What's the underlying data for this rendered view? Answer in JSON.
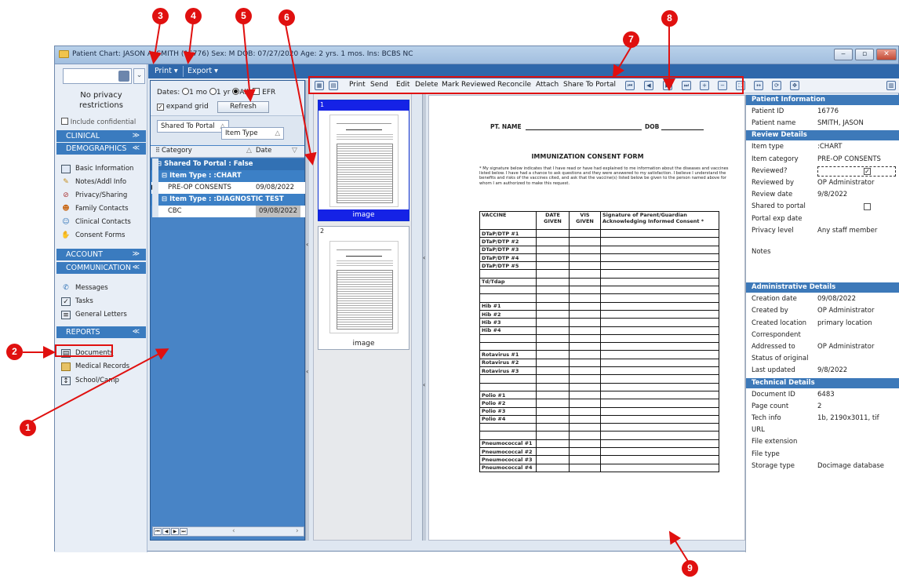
{
  "window": {
    "title": "Patient Chart: JASON A. SMITH (16776) Sex: M  DOB: 07/27/2020  Age: 2 yrs. 1 mos.  Ins: BCBS NC",
    "buttons": [
      "‒",
      "▫",
      "✕"
    ]
  },
  "sidebar": {
    "privacy_text": "No privacy restrictions",
    "include_confidential": "Include confidential",
    "sections": [
      {
        "label": "CLINICAL",
        "chevron": "≫"
      },
      {
        "label": "DEMOGRAPHICS",
        "chevron": "≪"
      },
      {
        "label": "ACCOUNT",
        "chevron": "≫"
      },
      {
        "label": "COMMUNICATION",
        "chevron": "≪"
      },
      {
        "label": "REPORTS",
        "chevron": "≪"
      }
    ],
    "demographics_items": [
      "Basic Information",
      "Notes/Addl Info",
      "Privacy/Sharing",
      "Family Contacts",
      "Clinical Contacts",
      "Consent Forms"
    ],
    "communication_items": [
      "Messages",
      "Tasks",
      "General Letters"
    ],
    "reports_items": [
      "Documents",
      "Medical Records",
      "School/Camp"
    ]
  },
  "menubar": {
    "print": "Print ▾",
    "export": "Export ▾"
  },
  "list": {
    "dates_label": "Dates:",
    "opt_1mo": "1 mo",
    "opt_1yr": "1 yr",
    "opt_all": "All",
    "efr": "EFR",
    "expand_grid": "expand grid",
    "refresh": "Refresh",
    "group_chip_1": "Shared To Portal",
    "group_chip_2": "Item Type",
    "col_category": "Category",
    "col_date": "Date",
    "group_shared": "Shared To Portal : False",
    "group_chart": "Item Type : :CHART",
    "row_1_cat": "PRE-OP CONSENTS",
    "row_1_date": "09/08/2022",
    "group_diag": "Item Type : :DIAGNOSTIC TEST",
    "row_2_cat": "CBC",
    "row_2_date": "09/08/2022"
  },
  "thumbnails": [
    {
      "num": "1",
      "label": "image"
    },
    {
      "num": "2",
      "label": "image"
    }
  ],
  "doc_toolbar": {
    "items": [
      "Print",
      "Send",
      "Edit",
      "Delete",
      "Mark Reviewed",
      "Reconcile",
      "Attach",
      "Share To Portal"
    ]
  },
  "document": {
    "pt_name": "PT. NAME",
    "dob": "DOB",
    "form_title": "IMMUNIZATION CONSENT FORM",
    "intro": "* My signature below indicates that I have read or have had explained to me information about the diseases and vaccines listed below. I have had a chance to ask questions and they were answered to my satisfaction. I believe I understand the benefits and risks of the vaccines cited, and ask that the vaccine(s) listed below be given to the person named above for whom I am authorized to make this request.",
    "col_vaccine": "VACCINE",
    "col_date": "DATE GIVEN",
    "col_vis": "VIS GIVEN",
    "col_sig": "Signature of Parent/Guardian Acknowledging Informed Consent *",
    "rows": [
      "DTaP/DTP #1",
      "DTaP/DTP #2",
      "DTaP/DTP #3",
      "DTaP/DTP #4",
      "DTaP/DTP #5",
      "",
      "Td/Tdap",
      "",
      "",
      "Hib #1",
      "Hib #2",
      "Hib #3",
      "Hib #4",
      "",
      "",
      "Rotavirus #1",
      "Rotavirus #2",
      "Rotavirus #3",
      "",
      "",
      "Polio #1",
      "Polio #2",
      "Polio #3",
      "Polio #4",
      "",
      "",
      "Pneumococcal #1",
      "Pneumococcal #2",
      "Pneumococcal #3",
      "Pneumococcal #4"
    ]
  },
  "properties": {
    "sections": [
      {
        "title": "Patient Information",
        "rows": [
          [
            "Patient ID",
            "16776"
          ],
          [
            "Patient name",
            "SMITH, JASON"
          ]
        ]
      },
      {
        "title": "Review Details",
        "rows": [
          [
            "Item type",
            ":CHART"
          ],
          [
            "Item category",
            "PRE-OP CONSENTS"
          ],
          [
            "Reviewed?",
            ""
          ],
          [
            "Reviewed by",
            "OP Administrator"
          ],
          [
            "Review date",
            "9/8/2022"
          ],
          [
            "Shared to portal",
            ""
          ],
          [
            "Portal exp date",
            ""
          ],
          [
            "Privacy level",
            "Any staff member"
          ],
          [
            "Notes",
            ""
          ]
        ]
      },
      {
        "title": "Administrative Details",
        "rows": [
          [
            "Creation date",
            "09/08/2022"
          ],
          [
            "Created by",
            "OP Administrator"
          ],
          [
            "Created location",
            "primary location"
          ],
          [
            "Correspondent",
            ""
          ],
          [
            "Addressed to",
            "OP Administrator"
          ],
          [
            "Status of original",
            ""
          ],
          [
            "Last updated",
            "9/8/2022"
          ]
        ]
      },
      {
        "title": "Technical Details",
        "rows": [
          [
            "Document ID",
            "6483"
          ],
          [
            "Page count",
            "2"
          ],
          [
            "Tech info",
            "1b, 2190x3011, tif"
          ],
          [
            "URL",
            ""
          ],
          [
            "File extension",
            ""
          ],
          [
            "File type",
            ""
          ],
          [
            "Storage type",
            "Docimage database"
          ]
        ]
      }
    ]
  },
  "annotations": [
    "1",
    "2",
    "3",
    "4",
    "5",
    "6",
    "7",
    "8",
    "9"
  ],
  "colors": {
    "accent": "#3a7bbf",
    "annotation": "#e0100f",
    "panel": "#4884c6"
  }
}
